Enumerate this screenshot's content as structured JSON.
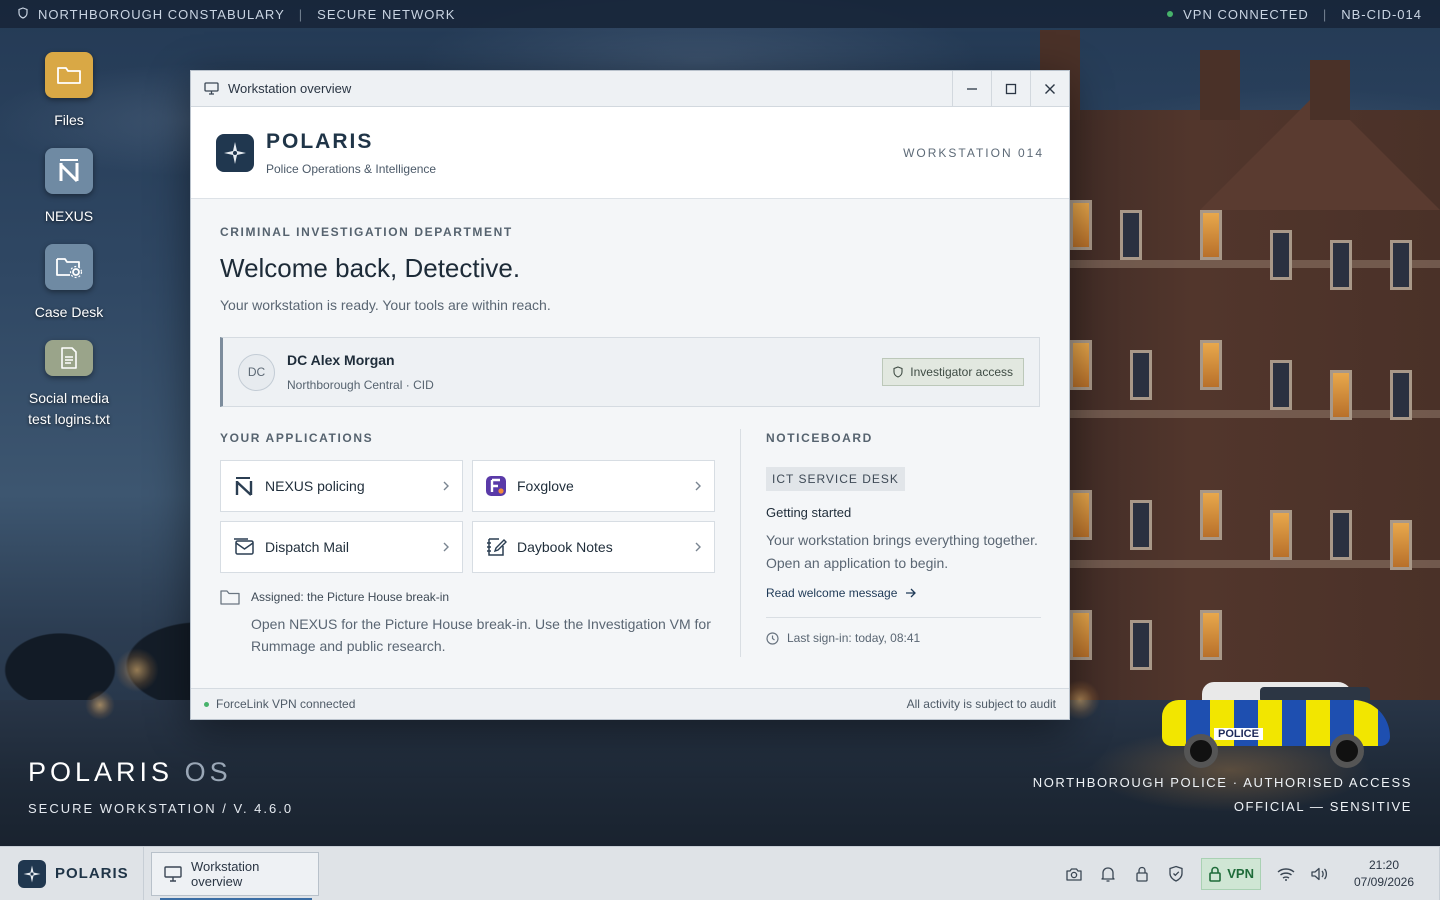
{
  "topbar": {
    "org": "NORTHBOROUGH CONSTABULARY",
    "network": "SECURE NETWORK",
    "vpn": "VPN CONNECTED",
    "host": "NB-CID-014"
  },
  "desktop": {
    "icons": [
      {
        "label": "Files",
        "icon": "folder-icon",
        "color": "#d9a845"
      },
      {
        "label": "NEXUS",
        "icon": "nexus-icon",
        "color": "#6f8aa3"
      },
      {
        "label": "Case Desk",
        "icon": "folder-gear-icon",
        "color": "#6f8aa3"
      },
      {
        "label": "Social media test logins.txt",
        "icon": "text-file-icon",
        "color": "#9aa48a"
      }
    ]
  },
  "window": {
    "title": "Workstation overview",
    "brand": {
      "name": "POLARIS",
      "subtitle": "Police Operations & Intelligence"
    },
    "workstation": "WORKSTATION 014",
    "department": "CRIMINAL INVESTIGATION DEPARTMENT",
    "welcome": "Welcome back, Detective.",
    "tagline": "Your workstation is ready. Your tools are within reach.",
    "user": {
      "initials": "DC",
      "name": "DC Alex Morgan",
      "unit": "Northborough Central · CID",
      "access": "Investigator access"
    },
    "apps_heading": "YOUR APPLICATIONS",
    "apps": [
      {
        "label": "NEXUS policing",
        "icon": "nexus-icon"
      },
      {
        "label": "Foxglove",
        "icon": "foxglove-icon"
      },
      {
        "label": "Dispatch Mail",
        "icon": "mail-icon"
      },
      {
        "label": "Daybook Notes",
        "icon": "notes-icon"
      }
    ],
    "assignment": {
      "heading": "Assigned: the Picture House break-in",
      "body": "Open NEXUS for the Picture House break-in. Use the Investigation VM for Rummage and public research."
    },
    "noticeboard": {
      "heading": "NOTICEBOARD",
      "tag": "ICT SERVICE DESK",
      "title": "Getting started",
      "body": "Your workstation brings everything together. Open an application to begin.",
      "link": "Read welcome message",
      "last_signin": "Last sign-in: today, 08:41"
    },
    "status": {
      "left": "ForceLink VPN connected",
      "right": "All activity is subject to audit"
    }
  },
  "os": {
    "name_main": "POLARIS",
    "name_dim": "OS",
    "version": "SECURE WORKSTATION / V. 4.6.0",
    "legal_line1": "NORTHBOROUGH POLICE · AUTHORISED ACCESS",
    "legal_line2": "OFFICIAL — SENSITIVE"
  },
  "taskbar": {
    "start_label": "POLARIS",
    "task": "Workstation overview",
    "vpn_label": "VPN",
    "time": "21:20",
    "date": "07/09/2026"
  },
  "colors": {
    "accent": "#20374f",
    "vpn_green": "#47b36b",
    "task_underline": "#3b6ea5"
  }
}
